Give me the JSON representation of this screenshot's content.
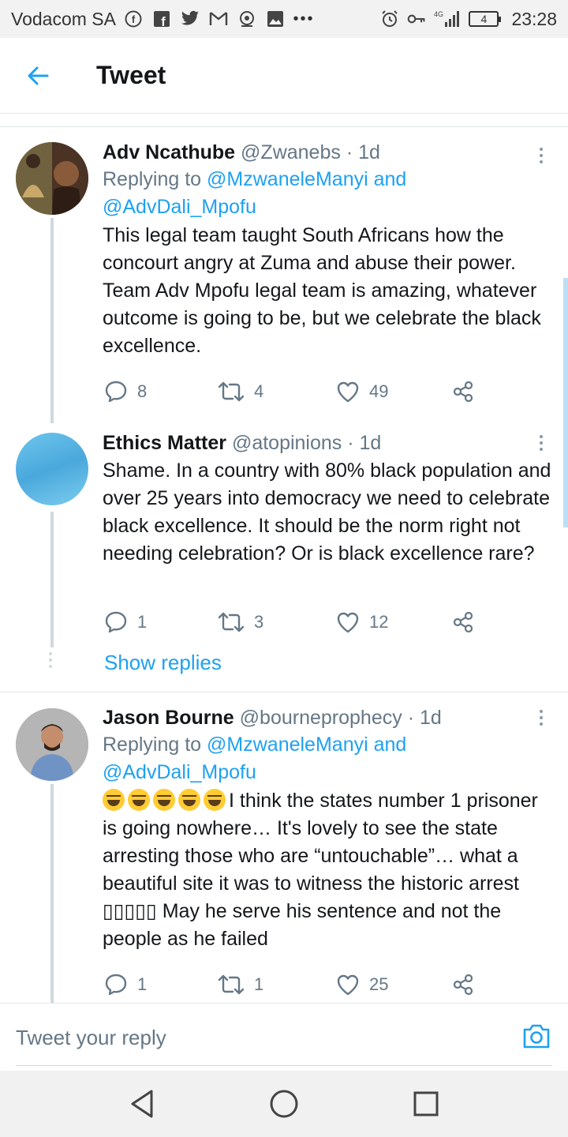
{
  "status_bar": {
    "carrier": "Vodacom SA",
    "network": "4G",
    "battery": "4",
    "time": "23:28"
  },
  "header": {
    "title": "Tweet"
  },
  "tweets": [
    {
      "name": "Adv Ncathube",
      "handle": "@Zwanebs",
      "time": "· 1d",
      "replying_prefix": "Replying to",
      "replying_mentions": "@MzwaneleManyi and",
      "replying_mentions_2": "@AdvDali_Mpofu",
      "text": "This legal team taught South Africans how the concourt angry at Zuma and abuse their power. Team Adv Mpofu legal team is amazing, whatever outcome is going to be, but we celebrate the black excellence.",
      "replies": "8",
      "retweets": "4",
      "likes": "49"
    },
    {
      "name": "Ethics Matter",
      "handle": "@atopinions",
      "time": "· 1d",
      "text": "Shame. In a country with 80% black population and over 25 years into democracy we need to celebrate black excellence. It should be the norm right not needing celebration? Or is black excellence rare?",
      "replies": "1",
      "retweets": "3",
      "likes": "12"
    },
    {
      "name": "Jason Bourne",
      "handle": "@bourneprophecy",
      "time": "· 1d",
      "replying_prefix": "Replying to",
      "replying_mentions": "@MzwaneleManyi and",
      "replying_mentions_2": "@AdvDali_Mpofu",
      "text": "I think the states number 1 prisoner is going nowhere… It's lovely to see the state arresting those who are “untouchable”… what a beautiful site it was to witness the historic arrest ▯▯▯▯▯ May he serve his sentence and not the people as he failed",
      "replies": "1",
      "retweets": "1",
      "likes": "25"
    }
  ],
  "show_replies": "Show replies",
  "reply_bar": {
    "placeholder": "Tweet your reply"
  },
  "colors": {
    "accent": "#1da1f2",
    "secondary_text": "#657786",
    "divider": "#e1e8ed"
  }
}
